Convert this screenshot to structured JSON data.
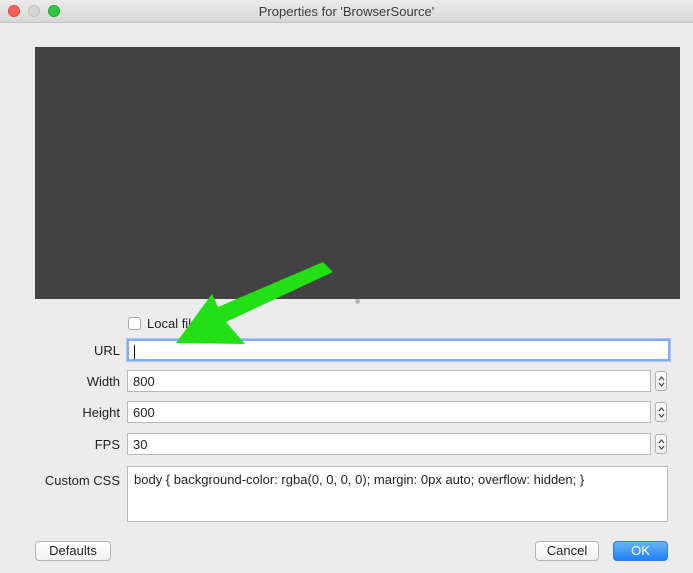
{
  "window": {
    "title": "Properties for 'BrowserSource'"
  },
  "form": {
    "local_file_label": "Local file",
    "url_label": "URL",
    "url_value": "",
    "width_label": "Width",
    "width_value": "800",
    "height_label": "Height",
    "height_value": "600",
    "fps_label": "FPS",
    "fps_value": "30",
    "css_label": "Custom CSS",
    "css_value": "body { background-color: rgba(0, 0, 0, 0); margin: 0px auto; overflow: hidden; }"
  },
  "buttons": {
    "defaults": "Defaults",
    "cancel": "Cancel",
    "ok": "OK"
  },
  "annotation": {
    "arrow_color": "#22e015"
  },
  "colors": {
    "accent": "#1d82f5",
    "preview_bg": "#424242"
  }
}
